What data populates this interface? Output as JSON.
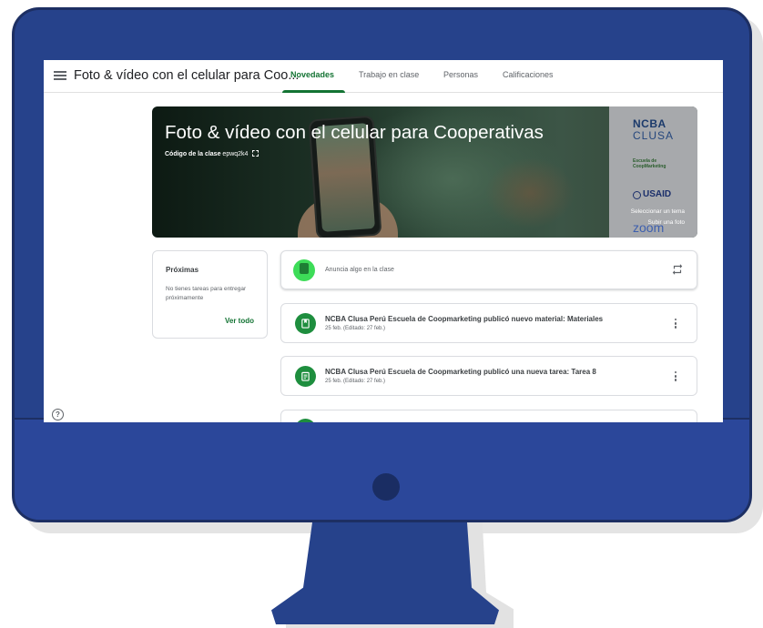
{
  "header": {
    "class_title": "Foto & vídeo con el celular para Coo...",
    "tabs": [
      {
        "label": "Novedades",
        "active": true
      },
      {
        "label": "Trabajo en clase",
        "active": false
      },
      {
        "label": "Personas",
        "active": false
      },
      {
        "label": "Calificaciones",
        "active": false
      }
    ]
  },
  "banner": {
    "title": "Foto & vídeo con el celular para Cooperativas",
    "class_code_label": "Código de la clase",
    "class_code": "epwq2k4",
    "select_theme": "Seleccionar un tema",
    "upload_photo": "Subir una foto",
    "logos": {
      "ncba": "NCBA",
      "clusa": "CLUSA",
      "escuela": "Escuela de CoopMarketing",
      "usaid": "USAID",
      "zoom": "zoom"
    }
  },
  "upcoming": {
    "title": "Próximas",
    "text": "No tienes tareas para entregar próximamente",
    "link": "Ver todo"
  },
  "announce": {
    "placeholder": "Anuncia algo en la clase"
  },
  "posts": [
    {
      "title": "NCBA Clusa Perú Escuela de Coopmarketing publicó nuevo material: Materiales",
      "date": "25 feb. (Editado: 27 feb.)",
      "icon": "material-icon"
    },
    {
      "title": "NCBA Clusa Perú Escuela de Coopmarketing publicó una nueva tarea: Tarea 8",
      "date": "25 feb. (Editado: 27 feb.)",
      "icon": "assignment-icon"
    }
  ],
  "colors": {
    "monitor": "#26428b",
    "accent_green": "#137333",
    "icon_green": "#1e8e3e"
  }
}
